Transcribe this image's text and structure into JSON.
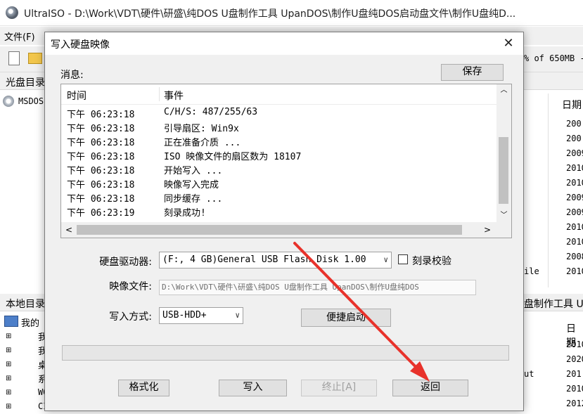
{
  "window": {
    "title": "UltraISO - D:\\Work\\VDT\\硬件\\研盛\\纯DOS U盘制作工具 UpanDOS\\制作U盘纯DOS启动盘文件\\制作U盘纯D..."
  },
  "menubar": {
    "file": "文件(F)"
  },
  "toolbar": {
    "capacity": "% of 650MB -"
  },
  "top_pane": {
    "left_header": "光盘目录",
    "tree_item": "MSDOS",
    "right_header": "日期",
    "dates": [
      "200",
      "200",
      "2009",
      "2010",
      "2010",
      "2009",
      "2009",
      "2010",
      "2010",
      "2008",
      "2010"
    ],
    "partial_file": "ile"
  },
  "bottom_pane": {
    "left_header": "本地目录",
    "tree_items": [
      "我的",
      "我",
      "我",
      "桌",
      "系",
      "WO",
      "CI"
    ],
    "path_partial": "盘制作工具 U",
    "right_header": "日期",
    "dates": [
      "2010",
      "2020",
      "201",
      "2010",
      "2012"
    ],
    "partial_out": "ut"
  },
  "dialog": {
    "title": "写入硬盘映像",
    "close": "✕",
    "messages_label": "消息:",
    "save_button": "保存",
    "log": {
      "col_time": "时间",
      "col_event": "事件",
      "rows": [
        {
          "time": "下午 06:23:18",
          "event": "C/H/S: 487/255/63"
        },
        {
          "time": "下午 06:23:18",
          "event": "引导扇区: Win9x"
        },
        {
          "time": "下午 06:23:18",
          "event": "正在准备介质 ..."
        },
        {
          "time": "下午 06:23:18",
          "event": "ISO 映像文件的扇区数为 18107"
        },
        {
          "time": "下午 06:23:18",
          "event": "开始写入 ..."
        },
        {
          "time": "下午 06:23:18",
          "event": "映像写入完成"
        },
        {
          "time": "下午 06:23:18",
          "event": "同步缓存 ..."
        },
        {
          "time": "下午 06:23:19",
          "event": "刻录成功!"
        }
      ]
    },
    "drive_label": "硬盘驱动器:",
    "drive_value": "(F:, 4 GB)General USB Flash Disk  1.00",
    "verify_label": "刻录校验",
    "image_label": "映像文件:",
    "image_value": "D:\\Work\\VDT\\硬件\\研盛\\纯DOS U盘制作工具 UpanDOS\\制作U盘纯DOS",
    "method_label": "写入方式:",
    "method_value": "USB-HDD+",
    "quick_boot": "便捷启动",
    "buttons": {
      "format": "格式化",
      "write": "写入",
      "stop": "终止[A]",
      "back": "返回"
    }
  },
  "colors": {
    "arrow": "#e8322b"
  }
}
